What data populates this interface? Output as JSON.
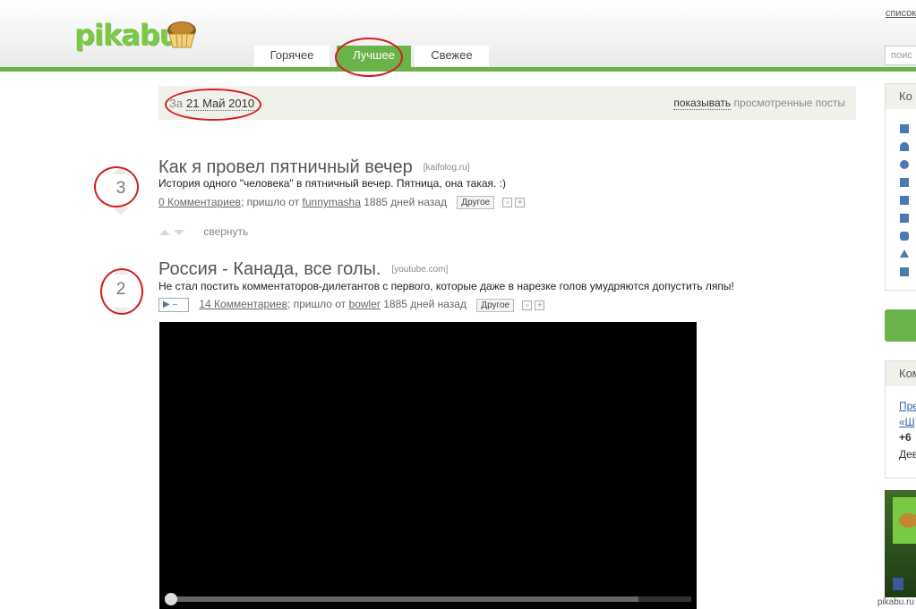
{
  "header": {
    "logo_text": "pikabu",
    "tabs": [
      {
        "label": "Горячее"
      },
      {
        "label": "Лучшее",
        "active": true
      },
      {
        "label": "Свежее"
      }
    ],
    "top_link": "список",
    "search_placeholder": "поис"
  },
  "datebar": {
    "prefix": "За",
    "date": "21 Май 2010",
    "show_label": "показывать",
    "viewed_label": "просмотренные посты"
  },
  "posts": [
    {
      "rating": "3",
      "title": "Как я провел пятничный вечер",
      "source": "[kaifolog.ru]",
      "description": "История одного \"человека\" в пятничный вечер. Пятница, она такая. :)",
      "comments": "0 Комментариев",
      "sent_from": "; пришло от",
      "author": "funnymasha",
      "age": "1885 дней назад",
      "other_label": "Другое",
      "collapse_label": "свернуть"
    },
    {
      "rating": "2",
      "title": "Россия - Канада, все голы.",
      "source": "[youtube.com]",
      "description": "Не стал постить комментаторов-дилетантов с первого, которые даже в нарезке голов умудряются допустить ляпы!",
      "comments": "14 Комментариев",
      "sent_from": "; пришло от",
      "author": "bowler",
      "age": "1885 дней назад",
      "other_label": "Другое",
      "video_progress": 0.9
    }
  ],
  "sidebar": {
    "box1_head": "Ко",
    "box2_head": "Ком",
    "box2_lines": [
      "Пре",
      "«Ш",
      "+6",
      "Дев"
    ]
  },
  "footer": {
    "credit": "pikabu.ru"
  },
  "colors": {
    "brand_green": "#6ab24a",
    "annotation_red": "#d12020"
  }
}
